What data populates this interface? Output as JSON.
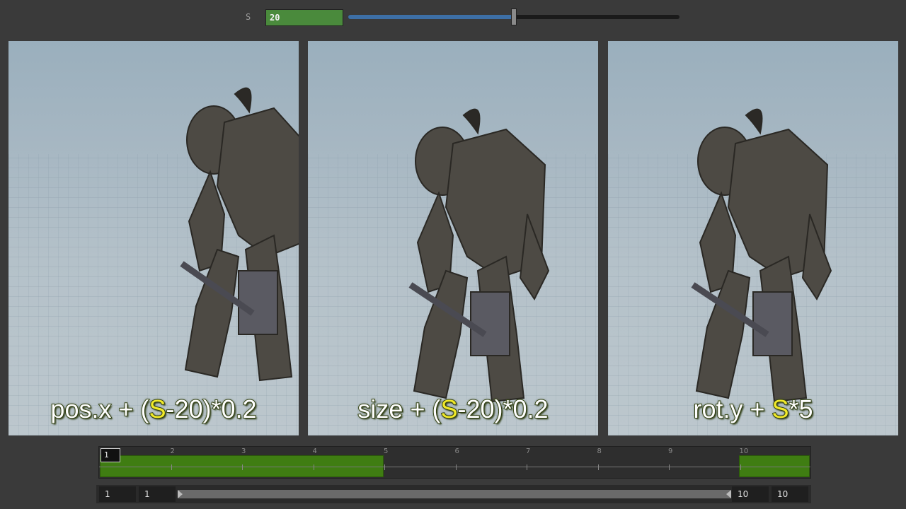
{
  "parameter": {
    "label": "S",
    "value": "20",
    "slider_fraction": 0.5
  },
  "viewports": [
    {
      "caption_pre": "pos.x + (",
      "caption_hl": "S",
      "caption_post": "-20)*0.2"
    },
    {
      "caption_pre": "size + (",
      "caption_hl": "S",
      "caption_post": "-20)*0.2"
    },
    {
      "caption_pre": "rot.y + ",
      "caption_hl": "S",
      "caption_post": "*5"
    }
  ],
  "timeline": {
    "current_frame": "1",
    "frame_numbers": [
      "2",
      "3",
      "4",
      "5",
      "6",
      "7",
      "8",
      "9",
      "10"
    ]
  },
  "range": {
    "start_outer": "1",
    "start_inner": "1",
    "end_inner": "10",
    "end_outer": "10"
  },
  "colors": {
    "param_field": "#4a8a3c",
    "slider_fill": "#3d6fa6",
    "keyframe": "#3f7d12",
    "caption_highlight": "#f2ea2a"
  }
}
